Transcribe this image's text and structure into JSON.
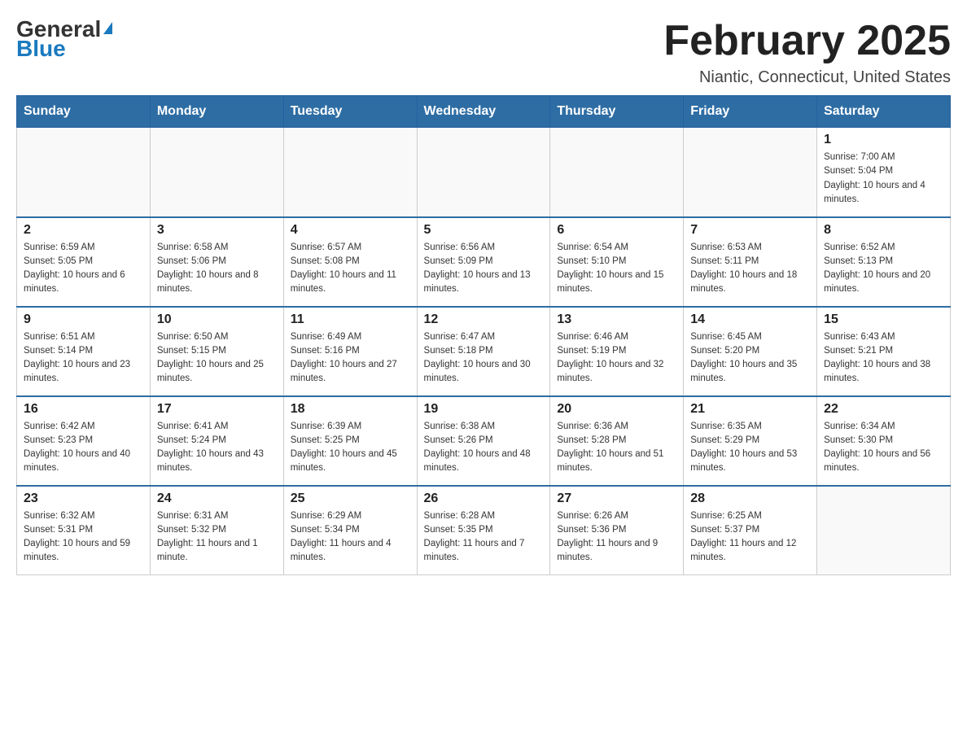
{
  "header": {
    "logo": {
      "general": "General",
      "blue": "Blue"
    },
    "title": "February 2025",
    "location": "Niantic, Connecticut, United States"
  },
  "days_of_week": [
    "Sunday",
    "Monday",
    "Tuesday",
    "Wednesday",
    "Thursday",
    "Friday",
    "Saturday"
  ],
  "weeks": [
    [
      {
        "day": "",
        "sunrise": "",
        "sunset": "",
        "daylight": ""
      },
      {
        "day": "",
        "sunrise": "",
        "sunset": "",
        "daylight": ""
      },
      {
        "day": "",
        "sunrise": "",
        "sunset": "",
        "daylight": ""
      },
      {
        "day": "",
        "sunrise": "",
        "sunset": "",
        "daylight": ""
      },
      {
        "day": "",
        "sunrise": "",
        "sunset": "",
        "daylight": ""
      },
      {
        "day": "",
        "sunrise": "",
        "sunset": "",
        "daylight": ""
      },
      {
        "day": "1",
        "sunrise": "Sunrise: 7:00 AM",
        "sunset": "Sunset: 5:04 PM",
        "daylight": "Daylight: 10 hours and 4 minutes."
      }
    ],
    [
      {
        "day": "2",
        "sunrise": "Sunrise: 6:59 AM",
        "sunset": "Sunset: 5:05 PM",
        "daylight": "Daylight: 10 hours and 6 minutes."
      },
      {
        "day": "3",
        "sunrise": "Sunrise: 6:58 AM",
        "sunset": "Sunset: 5:06 PM",
        "daylight": "Daylight: 10 hours and 8 minutes."
      },
      {
        "day": "4",
        "sunrise": "Sunrise: 6:57 AM",
        "sunset": "Sunset: 5:08 PM",
        "daylight": "Daylight: 10 hours and 11 minutes."
      },
      {
        "day": "5",
        "sunrise": "Sunrise: 6:56 AM",
        "sunset": "Sunset: 5:09 PM",
        "daylight": "Daylight: 10 hours and 13 minutes."
      },
      {
        "day": "6",
        "sunrise": "Sunrise: 6:54 AM",
        "sunset": "Sunset: 5:10 PM",
        "daylight": "Daylight: 10 hours and 15 minutes."
      },
      {
        "day": "7",
        "sunrise": "Sunrise: 6:53 AM",
        "sunset": "Sunset: 5:11 PM",
        "daylight": "Daylight: 10 hours and 18 minutes."
      },
      {
        "day": "8",
        "sunrise": "Sunrise: 6:52 AM",
        "sunset": "Sunset: 5:13 PM",
        "daylight": "Daylight: 10 hours and 20 minutes."
      }
    ],
    [
      {
        "day": "9",
        "sunrise": "Sunrise: 6:51 AM",
        "sunset": "Sunset: 5:14 PM",
        "daylight": "Daylight: 10 hours and 23 minutes."
      },
      {
        "day": "10",
        "sunrise": "Sunrise: 6:50 AM",
        "sunset": "Sunset: 5:15 PM",
        "daylight": "Daylight: 10 hours and 25 minutes."
      },
      {
        "day": "11",
        "sunrise": "Sunrise: 6:49 AM",
        "sunset": "Sunset: 5:16 PM",
        "daylight": "Daylight: 10 hours and 27 minutes."
      },
      {
        "day": "12",
        "sunrise": "Sunrise: 6:47 AM",
        "sunset": "Sunset: 5:18 PM",
        "daylight": "Daylight: 10 hours and 30 minutes."
      },
      {
        "day": "13",
        "sunrise": "Sunrise: 6:46 AM",
        "sunset": "Sunset: 5:19 PM",
        "daylight": "Daylight: 10 hours and 32 minutes."
      },
      {
        "day": "14",
        "sunrise": "Sunrise: 6:45 AM",
        "sunset": "Sunset: 5:20 PM",
        "daylight": "Daylight: 10 hours and 35 minutes."
      },
      {
        "day": "15",
        "sunrise": "Sunrise: 6:43 AM",
        "sunset": "Sunset: 5:21 PM",
        "daylight": "Daylight: 10 hours and 38 minutes."
      }
    ],
    [
      {
        "day": "16",
        "sunrise": "Sunrise: 6:42 AM",
        "sunset": "Sunset: 5:23 PM",
        "daylight": "Daylight: 10 hours and 40 minutes."
      },
      {
        "day": "17",
        "sunrise": "Sunrise: 6:41 AM",
        "sunset": "Sunset: 5:24 PM",
        "daylight": "Daylight: 10 hours and 43 minutes."
      },
      {
        "day": "18",
        "sunrise": "Sunrise: 6:39 AM",
        "sunset": "Sunset: 5:25 PM",
        "daylight": "Daylight: 10 hours and 45 minutes."
      },
      {
        "day": "19",
        "sunrise": "Sunrise: 6:38 AM",
        "sunset": "Sunset: 5:26 PM",
        "daylight": "Daylight: 10 hours and 48 minutes."
      },
      {
        "day": "20",
        "sunrise": "Sunrise: 6:36 AM",
        "sunset": "Sunset: 5:28 PM",
        "daylight": "Daylight: 10 hours and 51 minutes."
      },
      {
        "day": "21",
        "sunrise": "Sunrise: 6:35 AM",
        "sunset": "Sunset: 5:29 PM",
        "daylight": "Daylight: 10 hours and 53 minutes."
      },
      {
        "day": "22",
        "sunrise": "Sunrise: 6:34 AM",
        "sunset": "Sunset: 5:30 PM",
        "daylight": "Daylight: 10 hours and 56 minutes."
      }
    ],
    [
      {
        "day": "23",
        "sunrise": "Sunrise: 6:32 AM",
        "sunset": "Sunset: 5:31 PM",
        "daylight": "Daylight: 10 hours and 59 minutes."
      },
      {
        "day": "24",
        "sunrise": "Sunrise: 6:31 AM",
        "sunset": "Sunset: 5:32 PM",
        "daylight": "Daylight: 11 hours and 1 minute."
      },
      {
        "day": "25",
        "sunrise": "Sunrise: 6:29 AM",
        "sunset": "Sunset: 5:34 PM",
        "daylight": "Daylight: 11 hours and 4 minutes."
      },
      {
        "day": "26",
        "sunrise": "Sunrise: 6:28 AM",
        "sunset": "Sunset: 5:35 PM",
        "daylight": "Daylight: 11 hours and 7 minutes."
      },
      {
        "day": "27",
        "sunrise": "Sunrise: 6:26 AM",
        "sunset": "Sunset: 5:36 PM",
        "daylight": "Daylight: 11 hours and 9 minutes."
      },
      {
        "day": "28",
        "sunrise": "Sunrise: 6:25 AM",
        "sunset": "Sunset: 5:37 PM",
        "daylight": "Daylight: 11 hours and 12 minutes."
      },
      {
        "day": "",
        "sunrise": "",
        "sunset": "",
        "daylight": ""
      }
    ]
  ]
}
